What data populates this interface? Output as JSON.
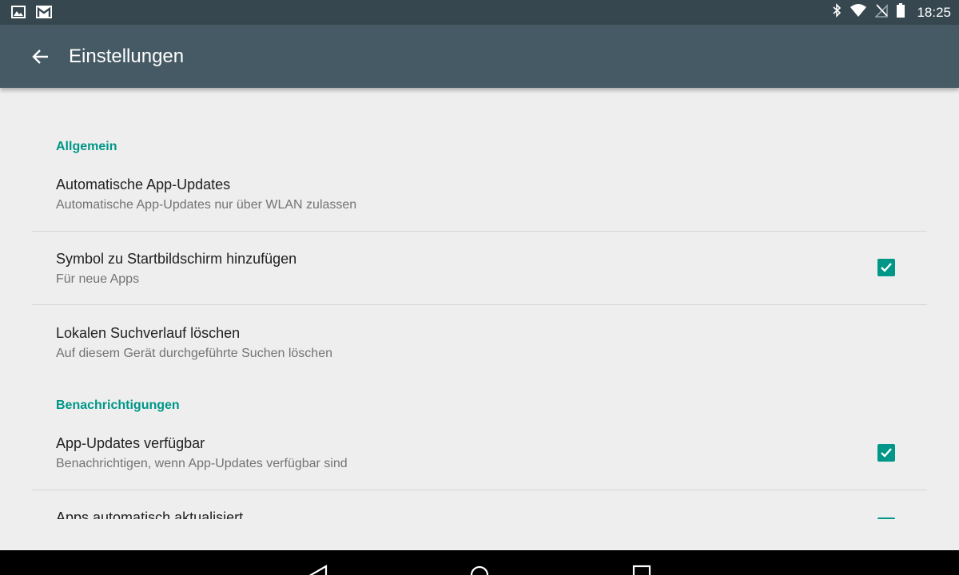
{
  "status_bar": {
    "time": "18:25",
    "left_icons": [
      "image-icon",
      "gmail-icon"
    ],
    "right_icons": [
      "bluetooth-icon",
      "wifi-icon",
      "no-sim-icon",
      "battery-icon"
    ]
  },
  "app_bar": {
    "title": "Einstellungen",
    "background_color": "#455a64"
  },
  "accent_color": "#009688",
  "sections": [
    {
      "header": "Allgemein",
      "items": [
        {
          "title": "Automatische App-Updates",
          "summary": "Automatische App-Updates nur über WLAN zulassen",
          "checkbox": null
        },
        {
          "title": "Symbol zu Startbildschirm hinzufügen",
          "summary": "Für neue Apps",
          "checkbox": true
        },
        {
          "title": "Lokalen Suchverlauf löschen",
          "summary": "Auf diesem Gerät durchgeführte Suchen löschen",
          "checkbox": null
        }
      ]
    },
    {
      "header": "Benachrichtigungen",
      "items": [
        {
          "title": "App-Updates verfügbar",
          "summary": "Benachrichtigen, wenn App-Updates verfügbar sind",
          "checkbox": true
        },
        {
          "title": "Apps automatisch aktualisiert",
          "summary": "",
          "checkbox": true
        }
      ]
    }
  ],
  "nav_bar": {
    "buttons": [
      "back-icon",
      "home-icon",
      "recents-icon"
    ]
  }
}
